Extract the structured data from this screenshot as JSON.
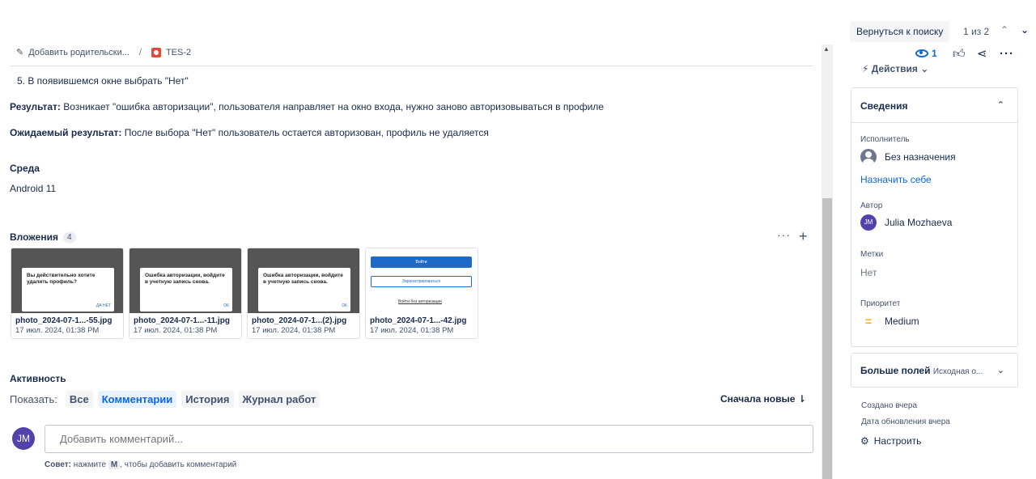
{
  "breadcrumb": {
    "parent_label": "Добавить родительски...",
    "separator": "/",
    "issue_key": "TES-2"
  },
  "description": {
    "step": "5. В появившемся окне выбрать \"Нет\"",
    "result_label": "Результат:",
    "result_text": " Возникает \"ошибка авторизации\", пользователя направляет на окно входа, нужно заново авторизовываться в профиле",
    "expected_label": "Ожидаемый результат:",
    "expected_text": " После выбора \"Нет\" пользователь остается авторизован, профиль не удаляется",
    "env_heading": "Среда",
    "env_value": "Android 11"
  },
  "attachments": {
    "heading": "Вложения",
    "count": "4",
    "more_label": "···",
    "add_label": "+",
    "items": [
      {
        "name": "photo_2024-07-1...-55.jpg",
        "date": "17 июл. 2024, 01:38 PM",
        "dialog": "Вы действительно хотите удалить профиль?",
        "button": "ДА   НЕТ"
      },
      {
        "name": "photo_2024-07-1...-11.jpg",
        "date": "17 июл. 2024, 01:38 PM",
        "dialog": "Ошибка авторизации, войдите в учетную запись снова.",
        "button": "ОК"
      },
      {
        "name": "photo_2024-07-1...(2).jpg",
        "date": "17 июл. 2024, 01:38 PM",
        "dialog": "Ошибка авторизации, войдите в учетную запись снова.",
        "button": "ОК"
      },
      {
        "name": "photo_2024-07-1...-42.jpg",
        "date": "17 июл. 2024, 01:38 PM",
        "btn1": "Войти",
        "btn2": "Зарегистрироваться",
        "link": "Войти без авторизации"
      }
    ]
  },
  "activity": {
    "heading": "Активность",
    "show_label": "Показать:",
    "filters": [
      "Все",
      "Комментарии",
      "История",
      "Журнал работ"
    ],
    "sort_label": "Сначала новые ⇂",
    "avatar_initials": "JM",
    "comment_placeholder": "Добавить комментарий...",
    "tip_label": "Совет:",
    "tip_pre": " нажмите ",
    "tip_key": "M",
    "tip_post": ", чтобы добавить комментарий"
  },
  "right_panel": {
    "back_label": "Вернуться к поиску",
    "pager": "1 из 2",
    "watch_count": "1",
    "actions_label": "Действия",
    "details": {
      "heading": "Сведения",
      "assignee_label": "Исполнитель",
      "assignee_value": "Без назначения",
      "assign_self": "Назначить себе",
      "author_label": "Автор",
      "author_initials": "JM",
      "author_name": "Julia Mozhaeva",
      "labels_label": "Метки",
      "labels_value": "Нет",
      "priority_label": "Приоритет",
      "priority_value": "Medium"
    },
    "more_fields": {
      "label": "Больше полей",
      "sub": "Исходная о..."
    },
    "created": "Создано вчера",
    "updated": "Дата обновления вчера",
    "configure": "Настроить"
  },
  "colors": {
    "accent": "#0c66e4",
    "avatar": "#5243aa",
    "bug": "#e5493a",
    "priority": "#ffab00"
  }
}
